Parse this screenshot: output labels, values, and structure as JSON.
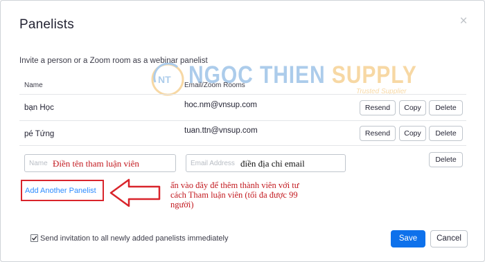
{
  "dialog": {
    "title": "Panelists",
    "close_glyph": "×",
    "subtitle": "Invite a person or a Zoom room as a webinar panelist"
  },
  "table": {
    "columns": [
      "Name",
      "Email/Zoom Rooms"
    ],
    "rows": [
      {
        "name": "bạn Học",
        "email": "hoc.nm@vnsup.com",
        "resend": "Resend",
        "copy": "Copy",
        "delete": "Delete"
      },
      {
        "name": "pé Tứng",
        "email": "tuan.ttn@vnsup.com",
        "resend": "Resend",
        "copy": "Copy",
        "delete": "Delete"
      }
    ]
  },
  "new_row": {
    "name_placeholder": "Name",
    "name_note": "Điền tên tham luận viên",
    "email_placeholder": "Email Address",
    "email_note": "điền địa chỉ email",
    "delete": "Delete"
  },
  "add_panelist_label": "Add Another Panelist",
  "annotation": {
    "lines": [
      "ấn vào đây để thêm thành viên với tư",
      "cách Tham luận viên (tối đa được 99",
      "người)"
    ],
    "color": "#c2181e"
  },
  "footer": {
    "checkbox_checked": true,
    "checkbox_label": "Send invitation to all newly added panelists immediately",
    "save": "Save",
    "cancel": "Cancel"
  },
  "watermark": {
    "brand": "NGOC THIEN",
    "brand_suffix": "SUPPLY",
    "logo_text": "NT",
    "tagline": "Trusted Supplier"
  },
  "colors": {
    "primary": "#0e71eb",
    "link": "#2d8cff",
    "highlight_red": "#d9242b"
  }
}
